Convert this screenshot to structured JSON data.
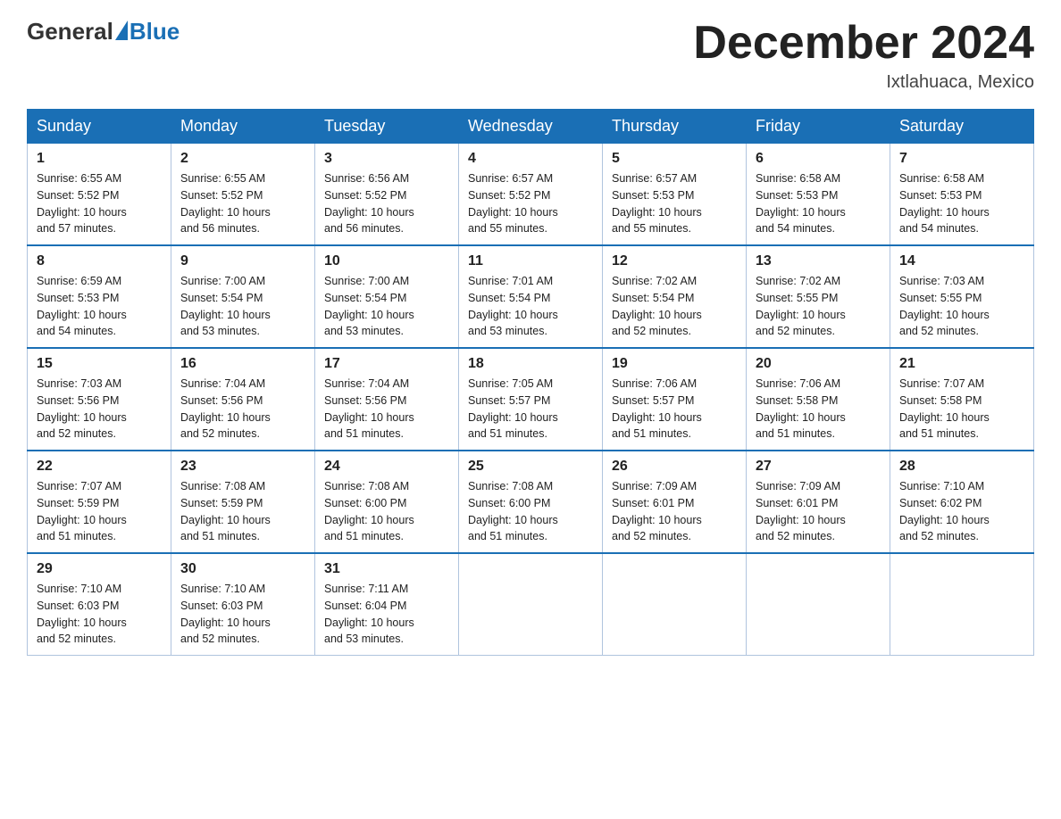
{
  "header": {
    "logo": {
      "general": "General",
      "blue": "Blue"
    },
    "title": "December 2024",
    "location": "Ixtlahuaca, Mexico"
  },
  "days_of_week": [
    "Sunday",
    "Monday",
    "Tuesday",
    "Wednesday",
    "Thursday",
    "Friday",
    "Saturday"
  ],
  "weeks": [
    [
      {
        "day": "1",
        "sunrise": "6:55 AM",
        "sunset": "5:52 PM",
        "daylight": "10 hours and 57 minutes."
      },
      {
        "day": "2",
        "sunrise": "6:55 AM",
        "sunset": "5:52 PM",
        "daylight": "10 hours and 56 minutes."
      },
      {
        "day": "3",
        "sunrise": "6:56 AM",
        "sunset": "5:52 PM",
        "daylight": "10 hours and 56 minutes."
      },
      {
        "day": "4",
        "sunrise": "6:57 AM",
        "sunset": "5:52 PM",
        "daylight": "10 hours and 55 minutes."
      },
      {
        "day": "5",
        "sunrise": "6:57 AM",
        "sunset": "5:53 PM",
        "daylight": "10 hours and 55 minutes."
      },
      {
        "day": "6",
        "sunrise": "6:58 AM",
        "sunset": "5:53 PM",
        "daylight": "10 hours and 54 minutes."
      },
      {
        "day": "7",
        "sunrise": "6:58 AM",
        "sunset": "5:53 PM",
        "daylight": "10 hours and 54 minutes."
      }
    ],
    [
      {
        "day": "8",
        "sunrise": "6:59 AM",
        "sunset": "5:53 PM",
        "daylight": "10 hours and 54 minutes."
      },
      {
        "day": "9",
        "sunrise": "7:00 AM",
        "sunset": "5:54 PM",
        "daylight": "10 hours and 53 minutes."
      },
      {
        "day": "10",
        "sunrise": "7:00 AM",
        "sunset": "5:54 PM",
        "daylight": "10 hours and 53 minutes."
      },
      {
        "day": "11",
        "sunrise": "7:01 AM",
        "sunset": "5:54 PM",
        "daylight": "10 hours and 53 minutes."
      },
      {
        "day": "12",
        "sunrise": "7:02 AM",
        "sunset": "5:54 PM",
        "daylight": "10 hours and 52 minutes."
      },
      {
        "day": "13",
        "sunrise": "7:02 AM",
        "sunset": "5:55 PM",
        "daylight": "10 hours and 52 minutes."
      },
      {
        "day": "14",
        "sunrise": "7:03 AM",
        "sunset": "5:55 PM",
        "daylight": "10 hours and 52 minutes."
      }
    ],
    [
      {
        "day": "15",
        "sunrise": "7:03 AM",
        "sunset": "5:56 PM",
        "daylight": "10 hours and 52 minutes."
      },
      {
        "day": "16",
        "sunrise": "7:04 AM",
        "sunset": "5:56 PM",
        "daylight": "10 hours and 52 minutes."
      },
      {
        "day": "17",
        "sunrise": "7:04 AM",
        "sunset": "5:56 PM",
        "daylight": "10 hours and 51 minutes."
      },
      {
        "day": "18",
        "sunrise": "7:05 AM",
        "sunset": "5:57 PM",
        "daylight": "10 hours and 51 minutes."
      },
      {
        "day": "19",
        "sunrise": "7:06 AM",
        "sunset": "5:57 PM",
        "daylight": "10 hours and 51 minutes."
      },
      {
        "day": "20",
        "sunrise": "7:06 AM",
        "sunset": "5:58 PM",
        "daylight": "10 hours and 51 minutes."
      },
      {
        "day": "21",
        "sunrise": "7:07 AM",
        "sunset": "5:58 PM",
        "daylight": "10 hours and 51 minutes."
      }
    ],
    [
      {
        "day": "22",
        "sunrise": "7:07 AM",
        "sunset": "5:59 PM",
        "daylight": "10 hours and 51 minutes."
      },
      {
        "day": "23",
        "sunrise": "7:08 AM",
        "sunset": "5:59 PM",
        "daylight": "10 hours and 51 minutes."
      },
      {
        "day": "24",
        "sunrise": "7:08 AM",
        "sunset": "6:00 PM",
        "daylight": "10 hours and 51 minutes."
      },
      {
        "day": "25",
        "sunrise": "7:08 AM",
        "sunset": "6:00 PM",
        "daylight": "10 hours and 51 minutes."
      },
      {
        "day": "26",
        "sunrise": "7:09 AM",
        "sunset": "6:01 PM",
        "daylight": "10 hours and 52 minutes."
      },
      {
        "day": "27",
        "sunrise": "7:09 AM",
        "sunset": "6:01 PM",
        "daylight": "10 hours and 52 minutes."
      },
      {
        "day": "28",
        "sunrise": "7:10 AM",
        "sunset": "6:02 PM",
        "daylight": "10 hours and 52 minutes."
      }
    ],
    [
      {
        "day": "29",
        "sunrise": "7:10 AM",
        "sunset": "6:03 PM",
        "daylight": "10 hours and 52 minutes."
      },
      {
        "day": "30",
        "sunrise": "7:10 AM",
        "sunset": "6:03 PM",
        "daylight": "10 hours and 52 minutes."
      },
      {
        "day": "31",
        "sunrise": "7:11 AM",
        "sunset": "6:04 PM",
        "daylight": "10 hours and 53 minutes."
      },
      null,
      null,
      null,
      null
    ]
  ],
  "labels": {
    "sunrise": "Sunrise:",
    "sunset": "Sunset:",
    "daylight": "Daylight:"
  }
}
